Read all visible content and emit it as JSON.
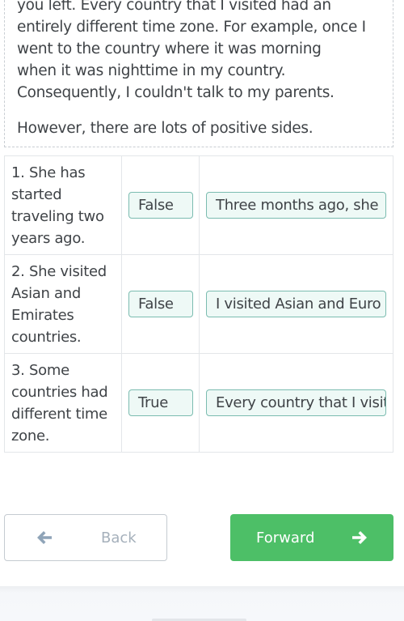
{
  "reading": {
    "paragraph1_lines": [
      "you left. Every country that I visited had an",
      "entirely different time zone. For example, once I",
      "went to the country where it was morning",
      "when it was nighttime in my country.",
      "Consequently, I couldn't talk to my parents."
    ],
    "paragraph2": "However, there are lots of positive sides."
  },
  "table": {
    "rows": [
      {
        "statement_lines": [
          "1. She has",
          "started",
          "traveling two",
          "years ago."
        ],
        "answer": "False",
        "evidence": "Three months ago, she"
      },
      {
        "statement_lines": [
          "2. She visited",
          "Asian and",
          "Emirates",
          "countries."
        ],
        "answer": "False",
        "evidence": "I visited Asian and Euro"
      },
      {
        "statement_lines": [
          "3. Some",
          "countries had",
          "different time",
          "zone."
        ],
        "answer": "True",
        "evidence": "Every country that I visit"
      }
    ]
  },
  "navigation": {
    "back_label": "Back",
    "back_icon": "arrow-left-icon",
    "forward_label": "Forward",
    "forward_icon": "arrow-right-icon"
  },
  "colors": {
    "accent_green": "#4dbf67",
    "chip_border": "#7bbcb0",
    "chip_fill": "#eef9f6"
  }
}
